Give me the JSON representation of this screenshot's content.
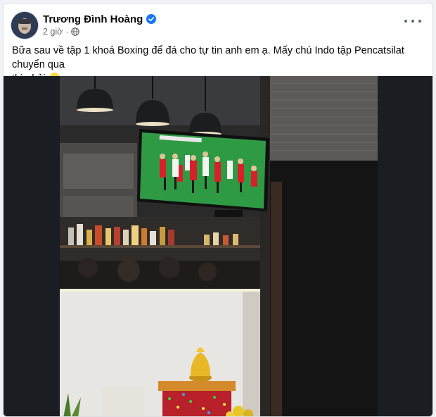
{
  "post": {
    "author": "Trương Đình Hoàng",
    "time": "2 giờ",
    "dot": "·",
    "text_line1": "Bữa sau về tập 1 khoá Boxing để đá cho tự tin anh em ạ. Mấy chú Indo tập Pencatsilat chuyển qua",
    "text_line2": "thì phải."
  },
  "icons": {
    "verified": "verified-badge-icon",
    "privacy": "globe-icon",
    "menu": "more-horizontal-icon",
    "emoji": "rolling-laughing-emoji-icon"
  },
  "colors": {
    "verified": "#1877f2",
    "meta_text": "#65676b",
    "pitch": "#2e9a44",
    "jersey_red": "#d8202a",
    "jersey_white": "#f2f4f0"
  }
}
